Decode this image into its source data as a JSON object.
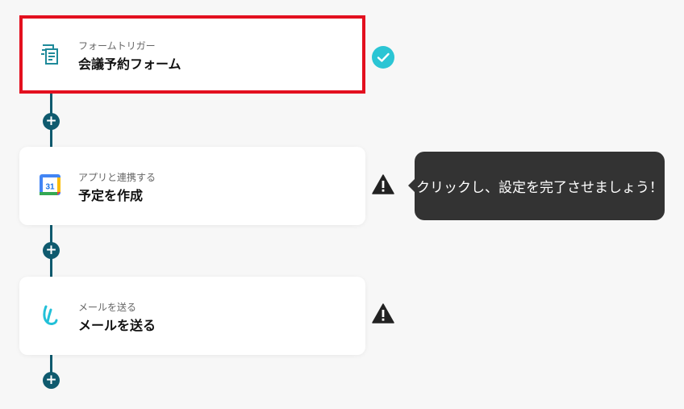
{
  "steps": [
    {
      "subtitle": "フォームトリガー",
      "title": "会議予約フォーム",
      "status": "complete",
      "icon": "form-icon"
    },
    {
      "subtitle": "アプリと連携する",
      "title": "予定を作成",
      "status": "warning",
      "icon": "google-calendar-icon",
      "calendar_day": "31"
    },
    {
      "subtitle": "メールを送る",
      "title": "メールを送る",
      "status": "warning",
      "icon": "mail-app-icon"
    }
  ],
  "tooltip": {
    "text": "クリックし、設定を完了させましょう！"
  },
  "add_step_label": "+",
  "colors": {
    "accent": "#0f5a6e",
    "selected_border": "#e3101f",
    "check": "#2bc5d4",
    "warning": "#222222",
    "tooltip_bg": "#333333"
  }
}
